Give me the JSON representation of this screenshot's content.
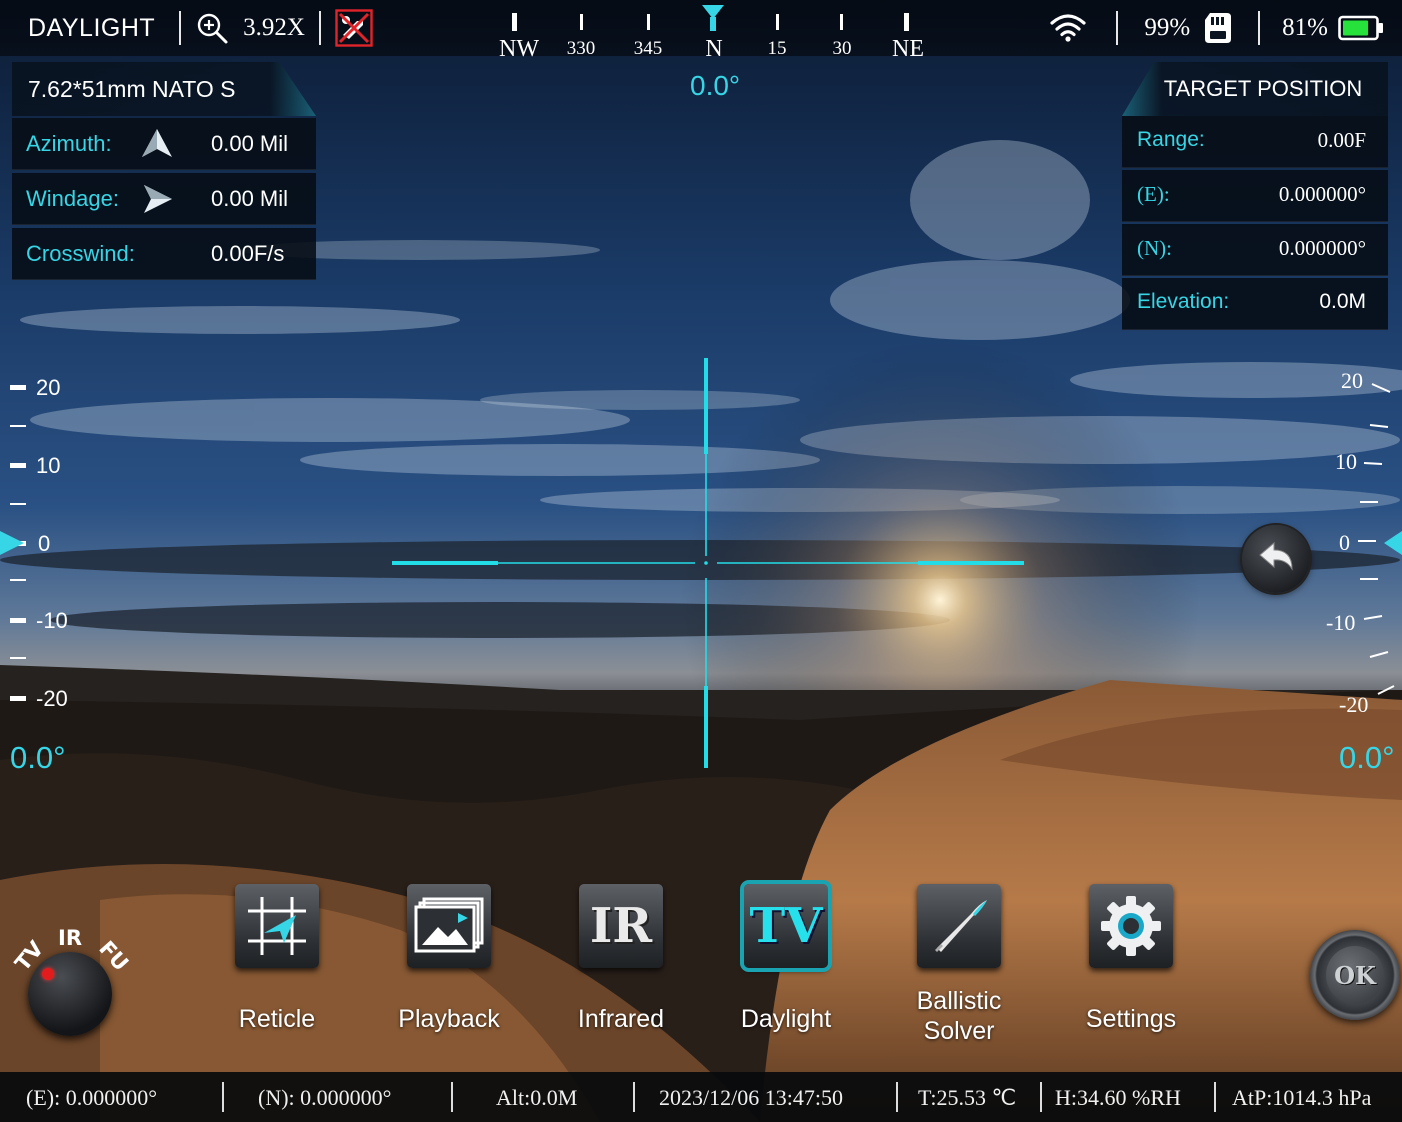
{
  "topbar": {
    "mode": "DAYLIGHT",
    "zoom": "3.92X",
    "compass": {
      "labels": [
        "NW",
        "330",
        "345",
        "N",
        "15",
        "30",
        "NE"
      ],
      "heading": "0.0°"
    },
    "wifi_level": "full",
    "storage_pct": "99%",
    "battery_pct": "81%",
    "battery_level": 0.81,
    "battery_color": "#27e23a"
  },
  "ammo": {
    "title": "7.62*51mm NATO S",
    "rows": [
      {
        "label": "Azimuth:",
        "value": "0.00 Mil",
        "icon": "up-arrow-icon"
      },
      {
        "label": "Windage:",
        "value": "0.00 Mil",
        "icon": "right-arrow-icon"
      },
      {
        "label": "Crosswind:",
        "value": "0.00F/s"
      }
    ]
  },
  "target": {
    "title": "TARGET POSITION",
    "rows": [
      {
        "label": "Range:",
        "value": "0.00F"
      },
      {
        "label": "(E):",
        "value": "0.000000°"
      },
      {
        "label": "(N):",
        "value": "0.000000°"
      },
      {
        "label": "Elevation:",
        "value": "0.0M"
      }
    ]
  },
  "left_scale": {
    "labels": [
      "20",
      "10",
      "0",
      "-10",
      "-20"
    ],
    "angle": "0.0°"
  },
  "right_scale": {
    "labels": [
      "20",
      "10",
      "0",
      "-10",
      "-20"
    ],
    "angle": "0.0°"
  },
  "knob": {
    "labels": [
      "TV",
      "IR",
      "FU"
    ]
  },
  "dock": {
    "reticle": "Reticle",
    "playback": "Playback",
    "infrared": "Infrared",
    "infrared_icon_text": "IR",
    "daylight": "Daylight",
    "daylight_icon_text": "TV",
    "ballistic_line1": "Ballistic",
    "ballistic_line2": "Solver",
    "settings": "Settings",
    "active": "daylight"
  },
  "ok_label": "OK",
  "status": {
    "east": "(E): 0.000000°",
    "north": "(N): 0.000000°",
    "alt": "Alt:0.0M",
    "datetime": "2023/12/06 13:47:50",
    "temp": "T:25.53 ℃",
    "humidity": "H:34.60 %RH",
    "pressure": "AtP:1014.3 hPa"
  },
  "colors": {
    "accent": "#36d6e6",
    "reticle": "#22dde8",
    "no_fire": "#e0242a"
  }
}
